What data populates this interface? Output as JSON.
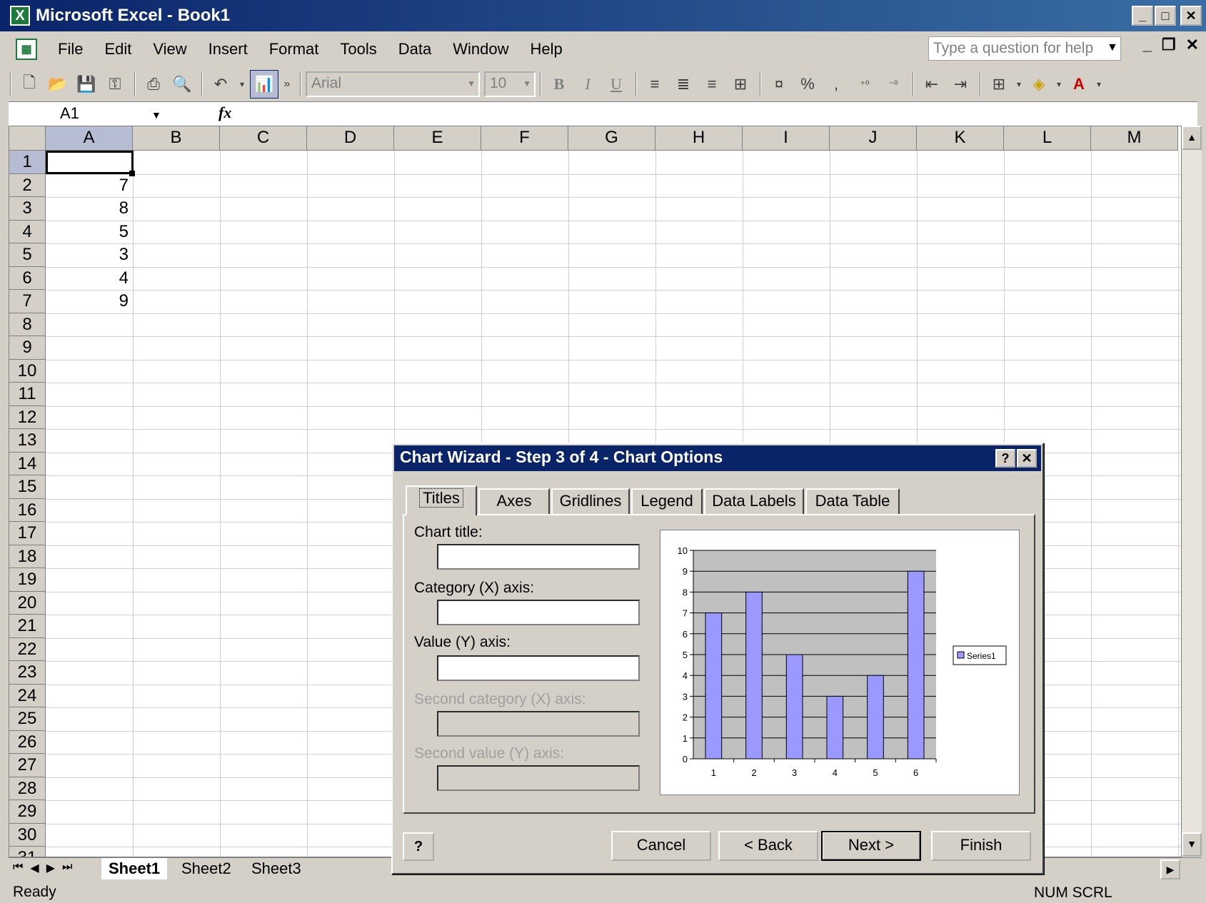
{
  "window": {
    "title": "Microsoft Excel - Book1",
    "controls": [
      "_",
      "□",
      "✕"
    ]
  },
  "menu": {
    "items": [
      {
        "label": "File"
      },
      {
        "label": "Edit"
      },
      {
        "label": "View"
      },
      {
        "label": "Insert"
      },
      {
        "label": "Format"
      },
      {
        "label": "Tools"
      },
      {
        "label": "Data"
      },
      {
        "label": "Window"
      },
      {
        "label": "Help"
      }
    ],
    "help_placeholder": "Type a question for help"
  },
  "toolbar": {
    "font": "Arial",
    "size": "10",
    "bold": "B",
    "italic": "I",
    "underline": "U",
    "percent": "%",
    "comma": ","
  },
  "formula_bar": {
    "name_box": "A1",
    "fx": "fx",
    "formula": ""
  },
  "grid": {
    "columns": [
      "A",
      "B",
      "C",
      "D",
      "E",
      "F",
      "G",
      "H",
      "I",
      "J",
      "K",
      "L",
      "M"
    ],
    "rows": [
      "1",
      "2",
      "3",
      "4",
      "5",
      "6",
      "7",
      "8",
      "9",
      "10",
      "11",
      "12",
      "13",
      "14",
      "15",
      "16",
      "17",
      "18",
      "19",
      "20",
      "21",
      "22",
      "23",
      "24",
      "25",
      "26",
      "27",
      "28",
      "29",
      "30",
      "31"
    ],
    "values": [
      "",
      "7",
      "8",
      "5",
      "3",
      "4",
      "9"
    ]
  },
  "sheets": {
    "tabs": [
      "Sheet1",
      "Sheet2",
      "Sheet3"
    ],
    "active": "Sheet1"
  },
  "status": {
    "ready": "Ready",
    "indicators": "NUM SCRL"
  },
  "dialog": {
    "title": "Chart Wizard - Step 3 of 4 - Chart Options",
    "tabs": [
      "Titles",
      "Axes",
      "Gridlines",
      "Legend",
      "Data Labels",
      "Data Table"
    ],
    "active_tab": "Titles",
    "fields": {
      "chart_title": {
        "label": "Chart title:",
        "value": ""
      },
      "category_axis": {
        "label": "Category (X) axis:",
        "value": ""
      },
      "value_axis": {
        "label": "Value (Y) axis:",
        "value": ""
      },
      "second_category_axis": {
        "label": "Second category (X) axis:",
        "value": ""
      },
      "second_value_axis": {
        "label": "Second value (Y) axis:",
        "value": ""
      }
    },
    "buttons": {
      "cancel": "Cancel",
      "back": "< Back",
      "next": "Next >",
      "finish": "Finish"
    }
  },
  "chart_data": {
    "type": "bar",
    "categories": [
      "1",
      "2",
      "3",
      "4",
      "5",
      "6"
    ],
    "series": [
      {
        "name": "Series1",
        "values": [
          7,
          8,
          5,
          3,
          4,
          9
        ]
      }
    ],
    "ylim": [
      0,
      10
    ],
    "yticks": [
      "0",
      "1",
      "2",
      "3",
      "4",
      "5",
      "6",
      "7",
      "8",
      "9",
      "10"
    ],
    "grid": true,
    "legend": "right",
    "bar_color": "#9999ff",
    "plot_bg": "#c0c0c0"
  }
}
